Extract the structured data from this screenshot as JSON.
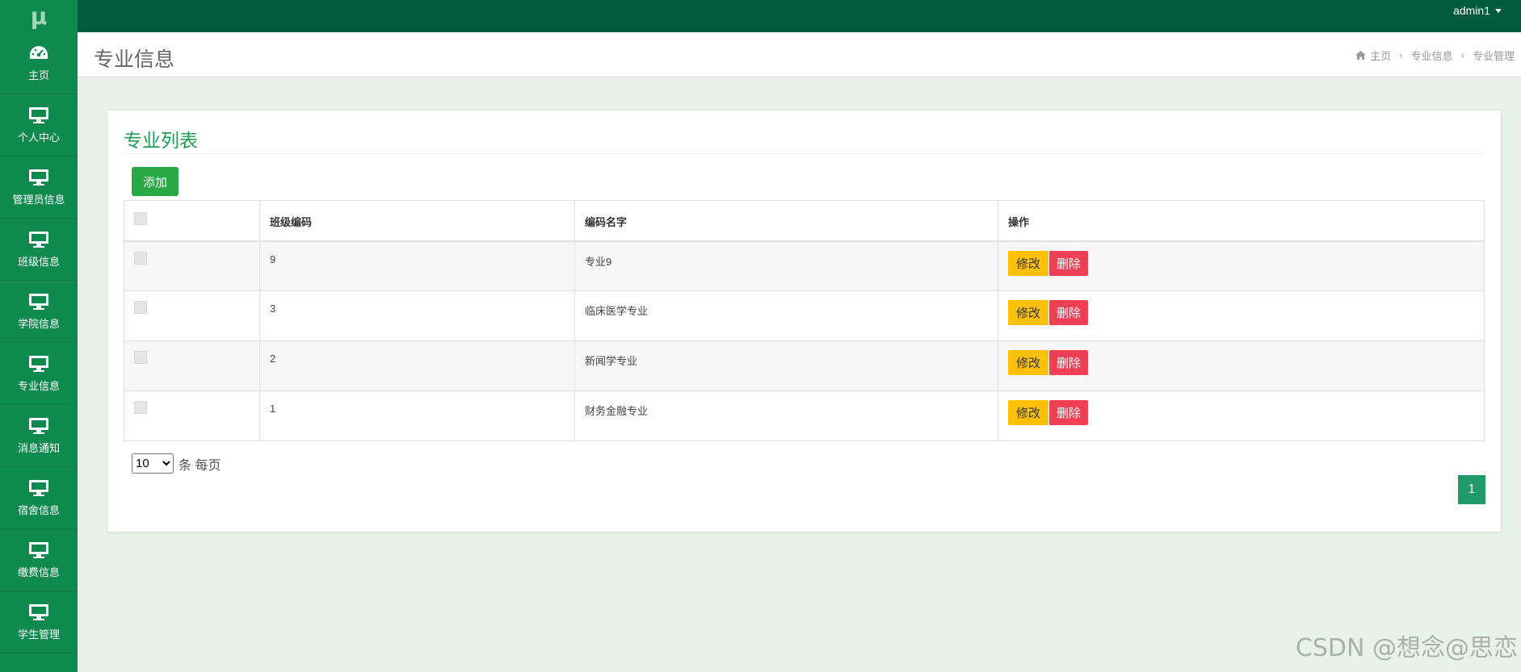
{
  "app": {
    "logo_text": "μ",
    "user": "admin1"
  },
  "sidebar": {
    "items": [
      {
        "label": "主页",
        "icon": "dashboard-icon"
      },
      {
        "label": "个人中心",
        "icon": "monitor-icon"
      },
      {
        "label": "管理员信息",
        "icon": "monitor-icon"
      },
      {
        "label": "班级信息",
        "icon": "monitor-icon"
      },
      {
        "label": "学院信息",
        "icon": "monitor-icon"
      },
      {
        "label": "专业信息",
        "icon": "monitor-icon"
      },
      {
        "label": "消息通知",
        "icon": "monitor-icon"
      },
      {
        "label": "宿舍信息",
        "icon": "monitor-icon"
      },
      {
        "label": "缴费信息",
        "icon": "monitor-icon"
      },
      {
        "label": "学生管理",
        "icon": "monitor-icon"
      }
    ]
  },
  "header": {
    "title": "专业信息",
    "breadcrumb": [
      "主页",
      "专业信息",
      "专业管理"
    ]
  },
  "card": {
    "title": "专业列表",
    "add_label": "添加"
  },
  "table": {
    "headers": [
      "",
      "班级编码",
      "编码名字",
      "操作"
    ],
    "rows": [
      {
        "code": "9",
        "name": "专业9"
      },
      {
        "code": "3",
        "name": "临床医学专业"
      },
      {
        "code": "2",
        "name": "新闻学专业"
      },
      {
        "code": "1",
        "name": "财务金融专业"
      }
    ],
    "edit_label": "修改",
    "delete_label": "删除"
  },
  "pagination": {
    "page_size": "10",
    "page_size_suffix": "条 每页",
    "current_page": "1"
  },
  "watermark": "CSDN @想念@思恋",
  "colors": {
    "topbar": "#005a3c",
    "sidebar": "#0e8a4f",
    "accent_green": "#28a745",
    "edit_button": "#ffc107",
    "delete_button": "#f03e55",
    "background": "#e6f2ea"
  }
}
